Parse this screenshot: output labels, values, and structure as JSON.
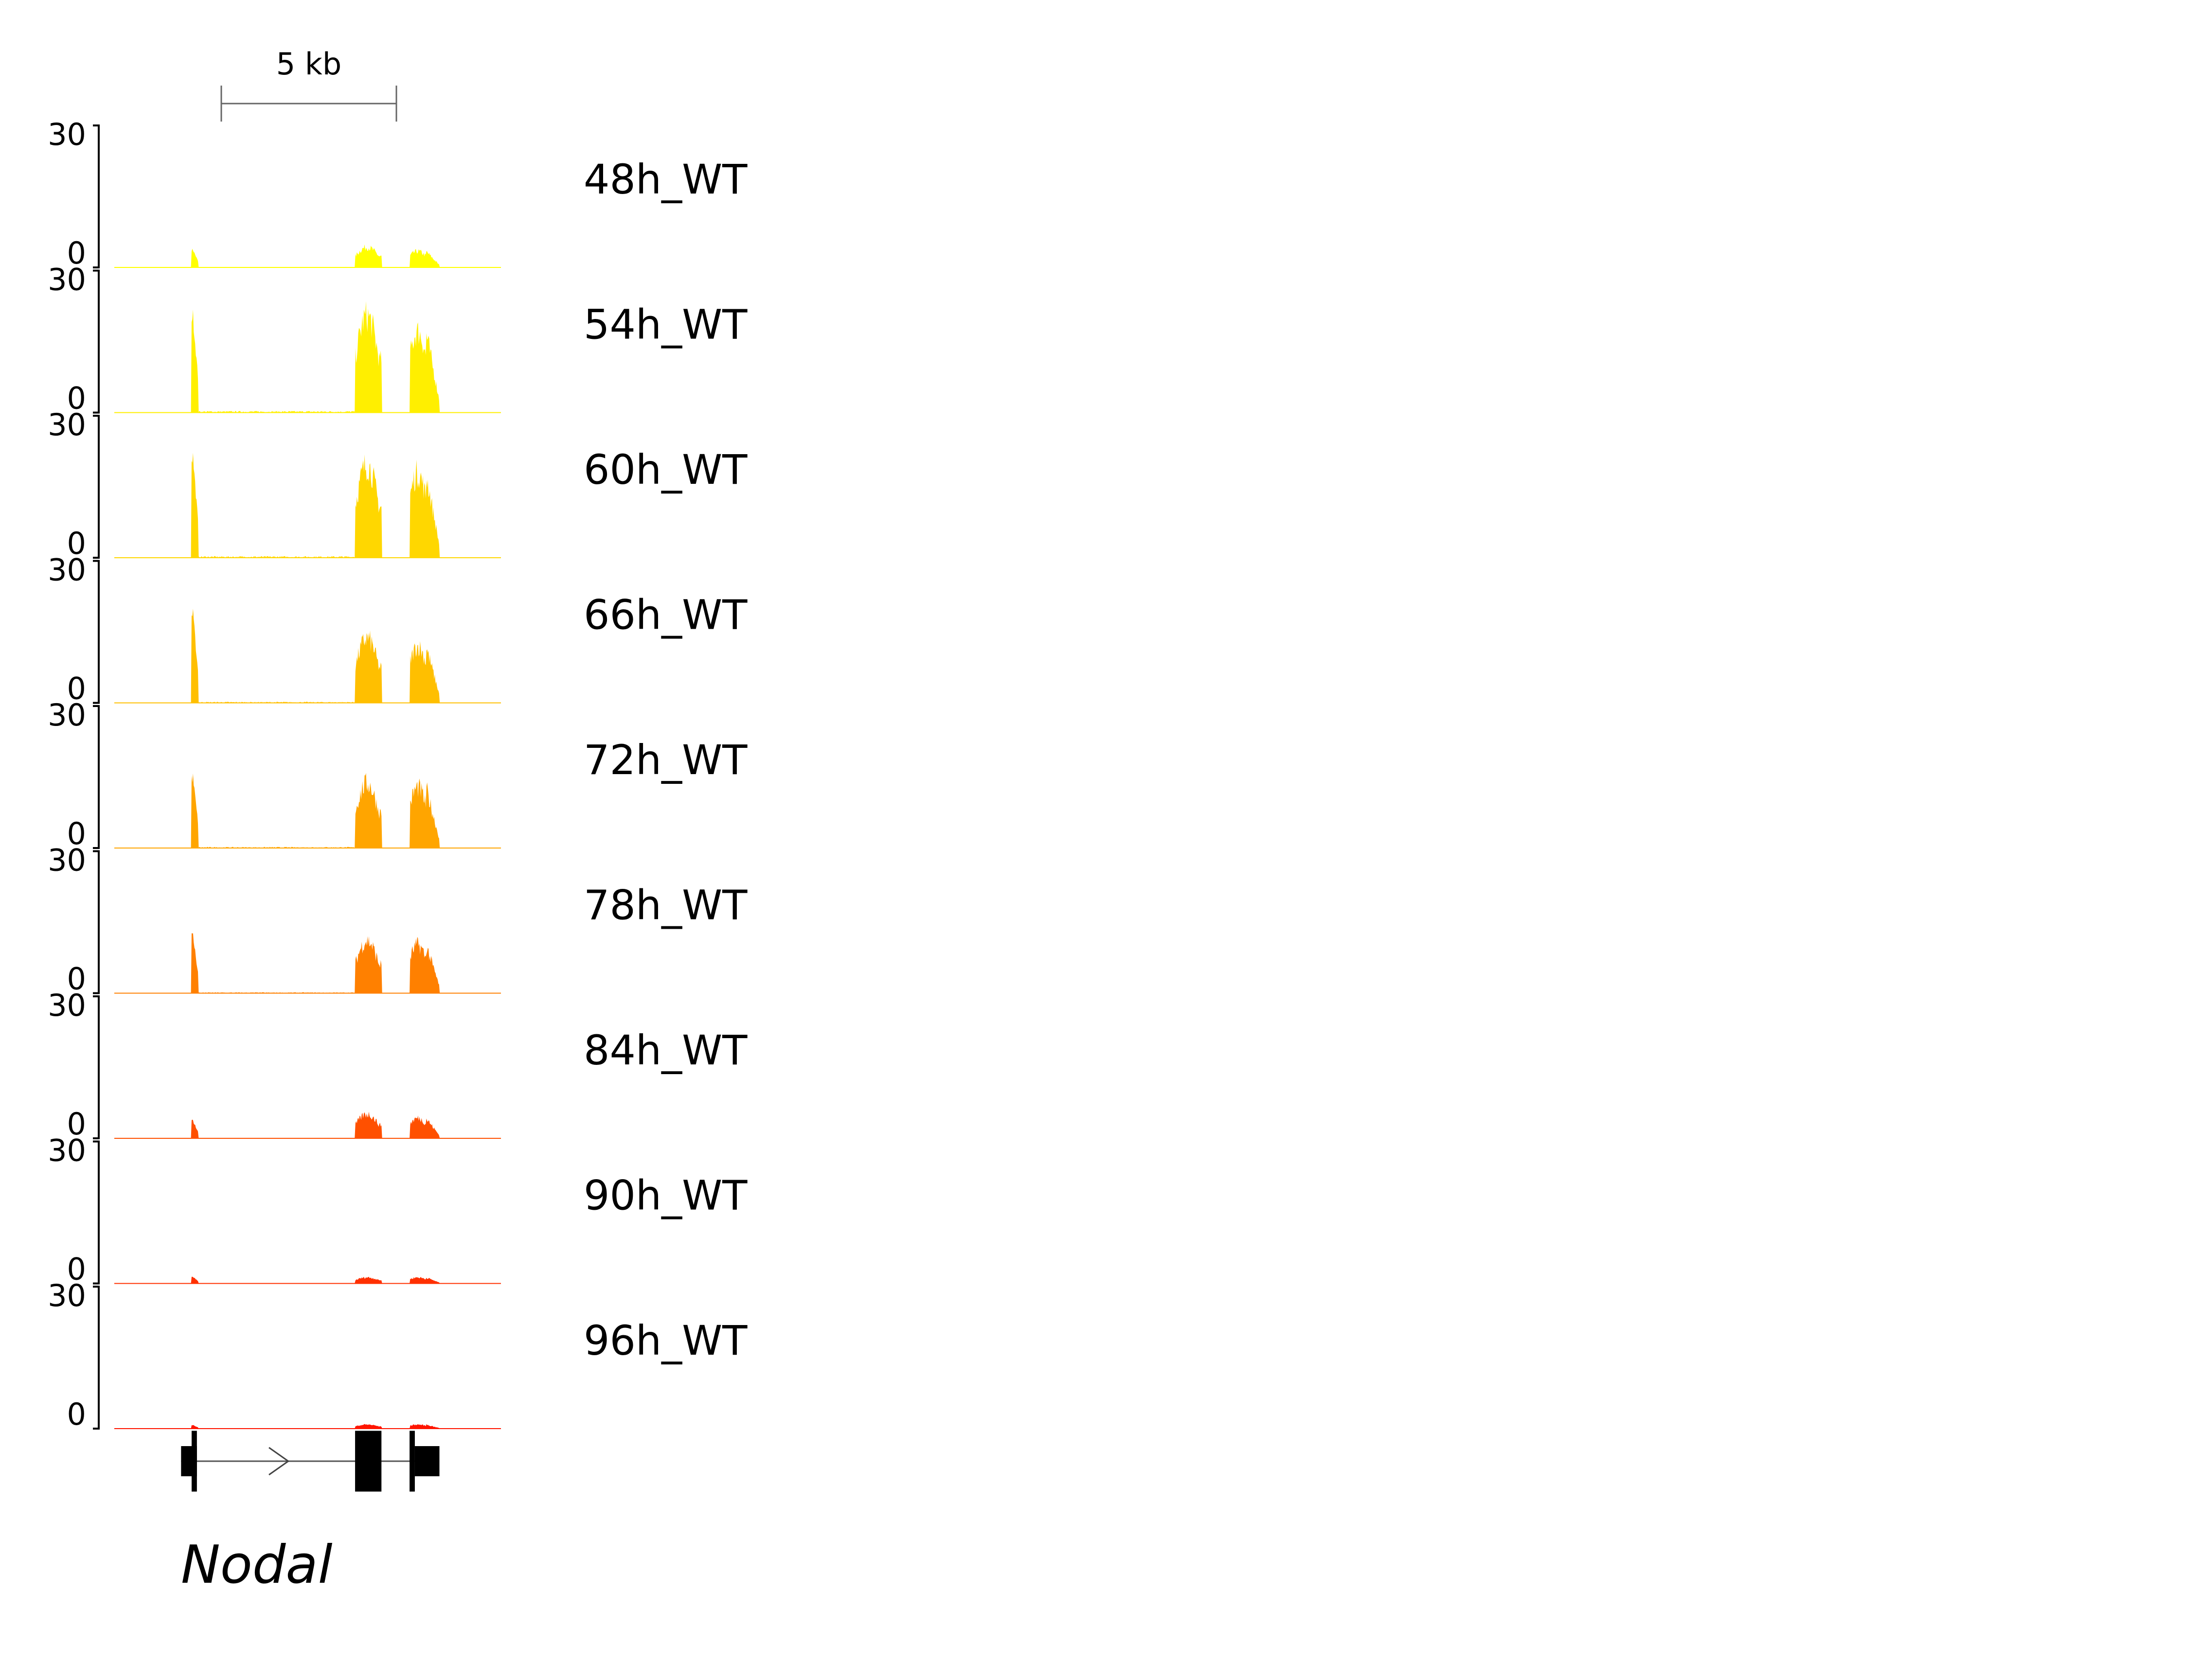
{
  "scale_bar": {
    "label": "5 kb",
    "length_kb": 5
  },
  "gene": {
    "name": "Nodal",
    "strand": "+"
  },
  "colors": {
    "axis": "#000000",
    "scale_bar": "#666666",
    "gene_model": "#000000"
  },
  "chart_data": {
    "type": "area",
    "description_of_axes": "genome coverage tracks",
    "ylim": [
      0,
      30
    ],
    "y_tick_labels": [
      "30",
      "0"
    ],
    "x_unit": "kb",
    "region_kb": [
      0,
      11
    ],
    "exons_kb": [
      {
        "start": 1.9,
        "end": 2.35,
        "kind": "utr"
      },
      {
        "start": 2.2,
        "end": 2.35,
        "kind": "cds"
      },
      {
        "start": 6.85,
        "end": 7.6,
        "kind": "cds"
      },
      {
        "start": 8.4,
        "end": 8.55,
        "kind": "cds"
      },
      {
        "start": 8.55,
        "end": 9.25,
        "kind": "utr"
      }
    ],
    "peak_regions_kb": [
      {
        "start": 2.2,
        "end": 2.4
      },
      {
        "start": 6.85,
        "end": 7.6
      },
      {
        "start": 8.4,
        "end": 9.25
      }
    ],
    "series": [
      {
        "name": "48h_WT",
        "color": "#ffff00",
        "peaks": [
          4,
          5,
          4
        ]
      },
      {
        "name": "54h_WT",
        "color": "#ffef00",
        "peaks": [
          22,
          24,
          20
        ]
      },
      {
        "name": "60h_WT",
        "color": "#ffd700",
        "peaks": [
          23,
          23,
          21
        ]
      },
      {
        "name": "66h_WT",
        "color": "#ffbf00",
        "peaks": [
          20,
          16,
          14
        ]
      },
      {
        "name": "72h_WT",
        "color": "#ffa500",
        "peaks": [
          16,
          16,
          15
        ]
      },
      {
        "name": "78h_WT",
        "color": "#ff8000",
        "peaks": [
          13,
          13,
          12
        ]
      },
      {
        "name": "84h_WT",
        "color": "#ff5000",
        "peaks": [
          4,
          6,
          5
        ]
      },
      {
        "name": "90h_WT",
        "color": "#ff3000",
        "peaks": [
          1.5,
          1.5,
          1.5
        ]
      },
      {
        "name": "96h_WT",
        "color": "#ff1500",
        "peaks": [
          0.8,
          1,
          1
        ]
      }
    ]
  }
}
